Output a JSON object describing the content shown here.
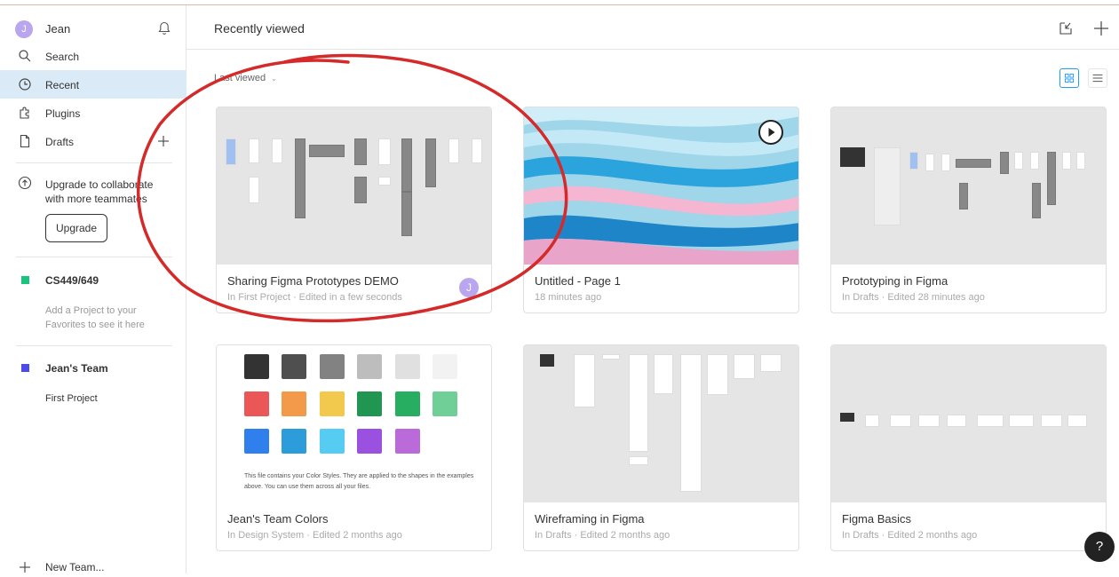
{
  "sidebar": {
    "user": {
      "initial": "J",
      "name": "Jean"
    },
    "nav": [
      {
        "label": "Search",
        "icon": "search-icon"
      },
      {
        "label": "Recent",
        "icon": "clock-icon",
        "active": true
      },
      {
        "label": "Plugins",
        "icon": "plugin-icon"
      },
      {
        "label": "Drafts",
        "icon": "file-icon"
      }
    ],
    "upgrade": {
      "text": "Upgrade to collaborate with more teammates",
      "button": "Upgrade"
    },
    "favorites": {
      "team": "CS449/649",
      "team_color": "#1bc47d",
      "hint": "Add a Project to your Favorites to see it here"
    },
    "team": {
      "name": "Jean's Team",
      "color": "#4b4bea",
      "project": "First Project"
    },
    "new_team": "New Team..."
  },
  "main": {
    "title": "Recently viewed",
    "sort_label": "Last viewed",
    "files": [
      {
        "title": "Sharing Figma Prototypes DEMO",
        "meta": "In First Project · Edited in a few seconds",
        "avatar": "J"
      },
      {
        "title": "Untitled - Page 1",
        "meta": "18 minutes ago"
      },
      {
        "title": "Prototyping in Figma",
        "meta": "In Drafts · Edited 28 minutes ago"
      },
      {
        "title": "Jean's Team Colors",
        "meta": "In Design System · Edited 2 months ago",
        "caption": "This file contains your Color Styles. They are applied to the shapes in the examples above. You can use them across all your files."
      },
      {
        "title": "Wireframing in Figma",
        "meta": "In Drafts · Edited 2 months ago"
      },
      {
        "title": "Figma Basics",
        "meta": "In Drafts · Edited 2 months ago"
      }
    ],
    "help_label": "?"
  },
  "colors": {
    "accent": "#18a0fb",
    "active_nav": "#daeaf7",
    "annotation": "#d42a2a",
    "swatches": [
      "#333333",
      "#4f4f4f",
      "#828282",
      "#bdbdbd",
      "#e0e0e0",
      "#f2f2f2",
      "#eb5757",
      "#f2994a",
      "#f2c94c",
      "#219653",
      "#27ae60",
      "#6fcf97",
      "#2f80ed",
      "#2d9cdb",
      "#56ccf2",
      "#9b51e0",
      "#bb6bd9"
    ]
  }
}
